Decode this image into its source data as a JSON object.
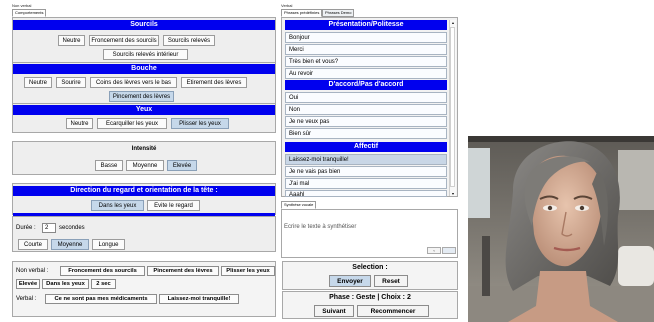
{
  "left_tabs": {
    "group_label": "Non verbal",
    "active_tab": "Comportements"
  },
  "sourcils": {
    "title": "Sourcils",
    "buttons": [
      "Neutre",
      "Froncement des sourcils",
      "Sourcils relevés",
      "Sourcils relevés intérieur"
    ]
  },
  "bouche": {
    "title": "Bouche",
    "buttons": [
      "Neutre",
      "Sourire",
      "Coins des lèvres vers le bas",
      "Etirement des lèvres",
      "Pincement des lèvres"
    ]
  },
  "yeux": {
    "title": "Yeux",
    "buttons": [
      "Neutre",
      "Ecarquiller les yeux",
      "Plisser les yeux"
    ]
  },
  "intensite": {
    "title": "Intensité",
    "buttons": [
      "Basse",
      "Moyenne",
      "Elevée"
    ]
  },
  "regard": {
    "title": "Direction du regard et orientation de la tête :",
    "buttons": [
      "Dans les yeux",
      "Evite le regard"
    ]
  },
  "duree": {
    "label": "Durée :",
    "value": "2",
    "unit": "secondes",
    "buttons": [
      "Courte",
      "Moyenne",
      "Longue"
    ]
  },
  "right_tabs": {
    "group_label": "Verbal",
    "tabs": [
      "Phrases prédéfinies",
      "Phrases Demo"
    ]
  },
  "politesse": {
    "title": "Présentation/Politesse",
    "items": [
      "Bonjour",
      "Merci",
      "Très bien et vous?",
      "Au revoir"
    ]
  },
  "accord": {
    "title": "D'accord/Pas d'accord",
    "items": [
      "Oui",
      "Non",
      "Je ne veux pas",
      "Bien sûr"
    ]
  },
  "affectif": {
    "title": "Affectif",
    "items": [
      "Laissez-moi tranquille!",
      "Je ne vais pas bien",
      "J'ai mal",
      "Aaahl"
    ]
  },
  "synthese": {
    "tab": "Synthèse vocale",
    "placeholder": "Ecrire le texte à synthétiser"
  },
  "summary": {
    "nonverbal_label": "Non verbal :",
    "nonverbal_items": [
      "Froncement des sourcils",
      "Pincement des lèvres",
      "Plisser les yeux",
      "Elevée",
      "Dans les yeux",
      "2 sec"
    ],
    "verbal_label": "Verbal :",
    "verbal_items": [
      "Ce ne sont pas mes médicaments",
      "Laissez-moi tranquille!"
    ]
  },
  "selection": {
    "title": "Selection :",
    "send": "Envoyer",
    "reset": "Reset"
  },
  "phase": {
    "text": "Phase : Geste | Choix : 2",
    "next": "Suivant",
    "restart": "Recommencer"
  },
  "colors": {
    "header_blue": "#0000ee",
    "selected": "#c6d8ea",
    "panel": "#eeeeee"
  }
}
